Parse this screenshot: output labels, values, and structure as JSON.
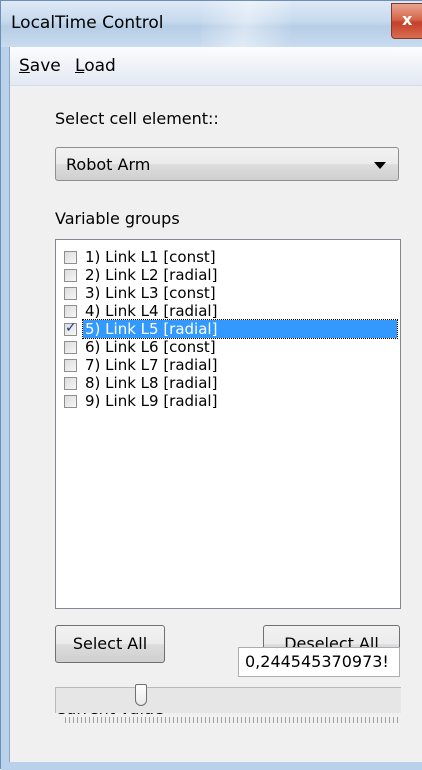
{
  "window": {
    "title": "LocalTime Control",
    "close_label": "x"
  },
  "menu": {
    "items": [
      {
        "accel": "S",
        "rest": "ave"
      },
      {
        "accel": "L",
        "rest": "oad"
      }
    ]
  },
  "cell_element": {
    "label": "Select cell element::",
    "selected": "Robot Arm"
  },
  "variable_groups": {
    "label": "Variable groups",
    "items": [
      {
        "label": "1) Link L1 [const]",
        "checked": false
      },
      {
        "label": "2) Link L2 [radial]",
        "checked": false
      },
      {
        "label": "3) Link L3 [const]",
        "checked": false
      },
      {
        "label": "4) Link L4 [radial]",
        "checked": false
      },
      {
        "label": "5) Link L5 [radial]",
        "checked": true
      },
      {
        "label": "6) Link L6 [const]",
        "checked": false
      },
      {
        "label": "7) Link L7 [radial]",
        "checked": false
      },
      {
        "label": "8) Link L8 [radial]",
        "checked": false
      },
      {
        "label": "9) Link L9 [radial]",
        "checked": false
      }
    ],
    "selected_index": 4
  },
  "buttons": {
    "select_all": "Select All",
    "deselect_all": "Deselect All"
  },
  "current_value": {
    "label": "Current value",
    "value": "0,244545370973!"
  },
  "slider": {
    "level": 0.24
  }
}
